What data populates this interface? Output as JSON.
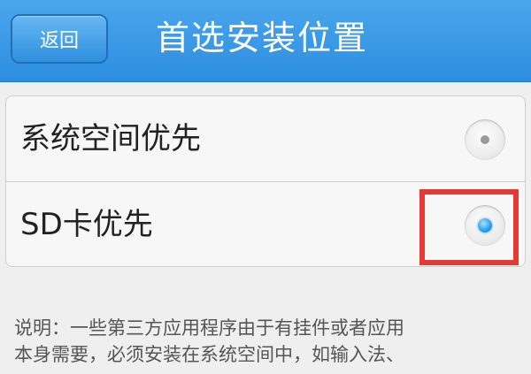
{
  "header": {
    "back_label": "返回",
    "title": "首选安装位置",
    "color": "#3399e6"
  },
  "options": [
    {
      "label": "系统空间优先",
      "selected": false
    },
    {
      "label": "SD卡优先",
      "selected": true
    }
  ],
  "description": {
    "line1": "说明：一些第三方应用程序由于有挂件或者应用",
    "line2": "本身需要，必须安装在系统空间中，如输入法、"
  },
  "highlight": {
    "color": "#e53935"
  }
}
